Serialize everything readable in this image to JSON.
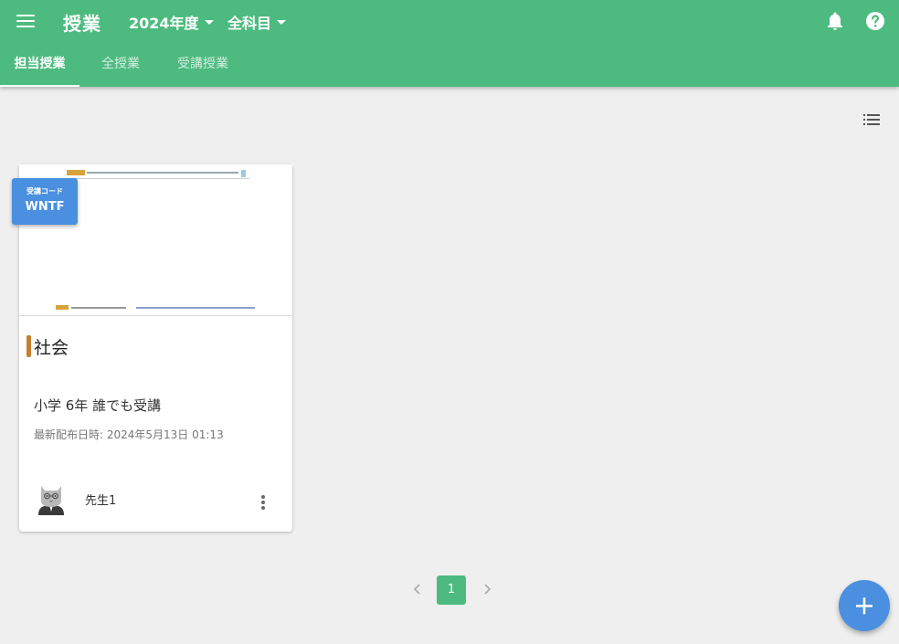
{
  "header": {
    "title": "授業",
    "year_dropdown": "2024年度",
    "subject_dropdown": "全科目"
  },
  "tabs": [
    {
      "label": "担当授業",
      "active": true
    },
    {
      "label": "全授業",
      "active": false
    },
    {
      "label": "受講授業",
      "active": false
    }
  ],
  "card": {
    "code_label": "受講コード",
    "code_value": "WNTF",
    "subject": "社会",
    "subject_color": "#c47f2c",
    "class_info": "小学 6年 誰でも受講",
    "latest_date": "最新配布日時: 2024年5月13日 01:13",
    "teacher": "先生1"
  },
  "pagination": {
    "current_page": "1"
  },
  "colors": {
    "primary": "#4dbb7f",
    "accent": "#4a8fe0",
    "background": "#efefef"
  },
  "icons": [
    "menu-icon",
    "bell-icon",
    "help-icon",
    "list-view-icon",
    "more-vert-icon",
    "chevron-left-icon",
    "chevron-right-icon",
    "plus-icon"
  ]
}
